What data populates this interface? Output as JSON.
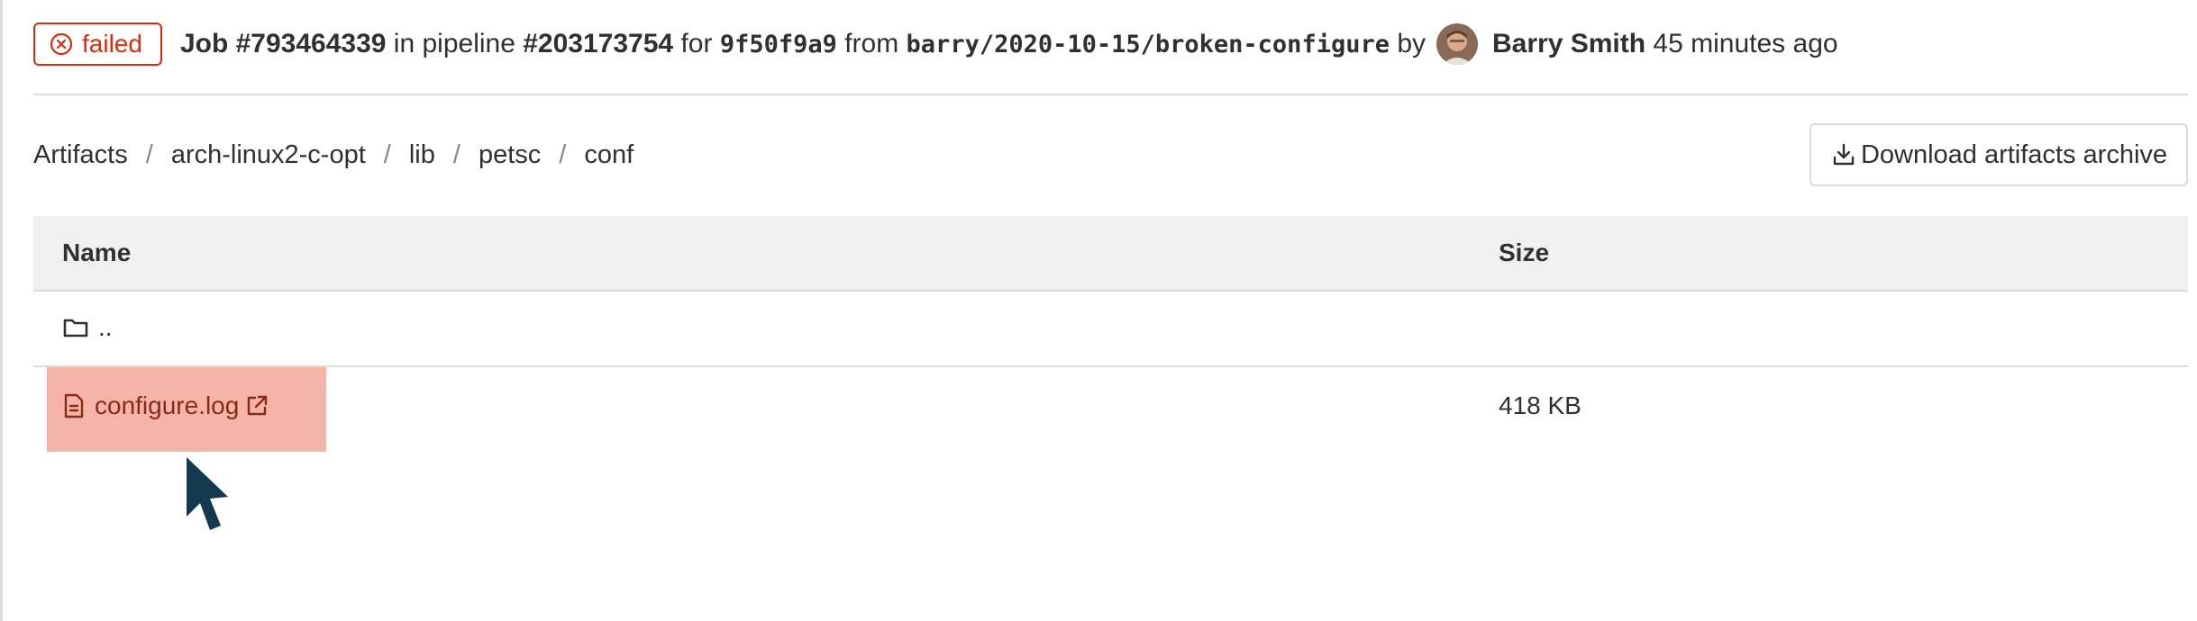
{
  "header": {
    "status_label": "failed",
    "job_label": "Job #793464339",
    "in_pipeline_text": "in pipeline",
    "pipeline_label": "#203173754",
    "for_text": "for",
    "commit_sha": "9f50f9a9",
    "from_text": "from",
    "branch": "barry/2020-10-15/broken-configure",
    "by_text": "by",
    "author": "Barry Smith",
    "time_ago": "45 minutes ago"
  },
  "breadcrumb": {
    "items": [
      "Artifacts",
      "arch-linux2-c-opt",
      "lib",
      "petsc",
      "conf"
    ],
    "separator": "/"
  },
  "download_button": {
    "label": "Download artifacts archive",
    "icon": "download-icon"
  },
  "table": {
    "headers": {
      "name": "Name",
      "size": "Size"
    },
    "parent_row": {
      "label": "..",
      "icon": "folder-icon"
    },
    "rows": [
      {
        "name": "configure.log",
        "size": "418 KB",
        "icon": "file-icon",
        "link_icon": "external-link-icon",
        "highlighted": true
      }
    ]
  },
  "colors": {
    "failed": "#dd2b0e",
    "highlight": "#f4b5a8",
    "arrow": "#123a4f",
    "header_bg": "#f0f0f0",
    "border": "#dbdbdb"
  }
}
